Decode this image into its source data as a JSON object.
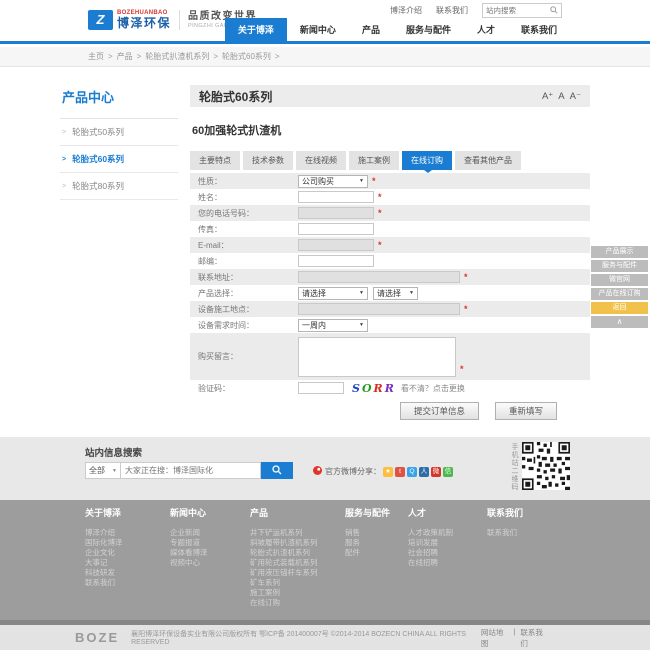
{
  "colors": {
    "accent_blue": "#1a7dd1",
    "highlight_yellow": "#f0c14b",
    "required_red": "#e0342b",
    "footer_gray": "#9d9d9d"
  },
  "topbar": {
    "links": [
      {
        "label": "博泽介绍"
      },
      {
        "label": "联系我们"
      }
    ],
    "search_placeholder": "站内搜索"
  },
  "logo": {
    "icon_glyph": "Z",
    "brand_en": "BOZEHUANBAO",
    "brand_cn": "博泽环保",
    "slogan_cn": "品质改变世界",
    "slogan_en": "PINGZHI GAIBIAN SHIJIE"
  },
  "nav": {
    "items": [
      {
        "label": "关于博泽"
      },
      {
        "label": "新闻中心"
      },
      {
        "label": "产品"
      },
      {
        "label": "服务与配件"
      },
      {
        "label": "人才"
      },
      {
        "label": "联系我们"
      }
    ]
  },
  "breadcrumb": {
    "sep": ">",
    "items": [
      "主页",
      "产品",
      "轮胎式扒渣机系列",
      "轮胎式60系列"
    ]
  },
  "sidebar": {
    "title": "产品中心",
    "arrow": ">",
    "items": [
      {
        "label": "轮胎式50系列"
      },
      {
        "label": "轮胎式60系列"
      },
      {
        "label": "轮胎式80系列"
      }
    ]
  },
  "product": {
    "series_title": "轮胎式60系列",
    "font_controls": [
      "A⁺",
      "A",
      "A⁻"
    ],
    "name": "60加强轮式扒渣机",
    "tabs": [
      {
        "label": "主要特点"
      },
      {
        "label": "技术参数"
      },
      {
        "label": "在线视频"
      },
      {
        "label": "施工案例"
      },
      {
        "label": "在线订购"
      },
      {
        "label": "查看其他产品"
      }
    ]
  },
  "form": {
    "required_mark": "*",
    "rows": [
      {
        "label": "性质：",
        "value": "公司购买"
      },
      {
        "label": "姓名："
      },
      {
        "label": "您的电话号码："
      },
      {
        "label": "传真："
      },
      {
        "label": "E-mail："
      },
      {
        "label": "邮编："
      },
      {
        "label": "联系地址："
      },
      {
        "label": "产品选择：",
        "value": "请选择",
        "value2": "请选择"
      },
      {
        "label": "设备施工地点："
      },
      {
        "label": "设备需求时间：",
        "value": "一周内"
      },
      {
        "label": "购买留言："
      },
      {
        "label": "验证码："
      }
    ],
    "captcha": {
      "c1": "S",
      "c2": "O",
      "c3": "R",
      "c4": "R",
      "hint": "看不清？点击更换"
    },
    "submit_label": "提交订单信息",
    "reset_label": "重新填写"
  },
  "float_menu": {
    "items": [
      {
        "label": "产品展示"
      },
      {
        "label": "服务与配件"
      },
      {
        "label": "微官网"
      },
      {
        "label": "产品在线订购"
      },
      {
        "label": "返回"
      }
    ],
    "top_label": "∧"
  },
  "search_band": {
    "title": "站内信息搜索",
    "category": "全部",
    "placeholder": "大家正在搜：博泽国际化",
    "weibo_label": "官方微博",
    "share_label": "分享：",
    "qr_label": "手机站二维码",
    "share_icons": [
      {
        "name": "qzone",
        "glyph": "★"
      },
      {
        "name": "tencent-weibo",
        "glyph": "t"
      },
      {
        "name": "qq",
        "glyph": "Q"
      },
      {
        "name": "renren",
        "glyph": "人"
      },
      {
        "name": "sina-weibo",
        "glyph": "微"
      },
      {
        "name": "wechat",
        "glyph": "信"
      }
    ]
  },
  "footer": {
    "columns": [
      {
        "title": "关于博泽",
        "links": [
          "博泽介绍",
          "国际化博泽",
          "企业文化",
          "大事记",
          "科技研发",
          "联系我们"
        ]
      },
      {
        "title": "新闻中心",
        "links": [
          "企业新闻",
          "专题报道",
          "媒体看博泽",
          "视频中心"
        ]
      },
      {
        "title": "产品",
        "links": [
          "井下铲运机系列",
          "斜坡履带扒渣机系列",
          "轮胎式扒渣机系列",
          "矿用轮式装载机系列",
          "矿用液压锚杆车系列",
          "矿车系列",
          "施工案例",
          "在线订购"
        ]
      },
      {
        "title": "服务与配件",
        "links": [
          "销售",
          "服务",
          "配件"
        ]
      },
      {
        "title": "人才",
        "links": [
          "人才政策机制",
          "培训发展",
          "社会招聘",
          "在线招聘"
        ]
      },
      {
        "title": "联系我们",
        "links": [
          "联系我们"
        ]
      }
    ]
  },
  "bottombar": {
    "logo": "BOZE",
    "copyright": "襄阳博泽环保设备实业有限公司版权所有  鄂ICP备 201400007号  ©2014-2014 BOZECN CHINA ALL RIGHTS RESERVED",
    "link_sep": "|",
    "links": [
      {
        "label": "网站地图"
      },
      {
        "label": "联系我们"
      }
    ]
  }
}
